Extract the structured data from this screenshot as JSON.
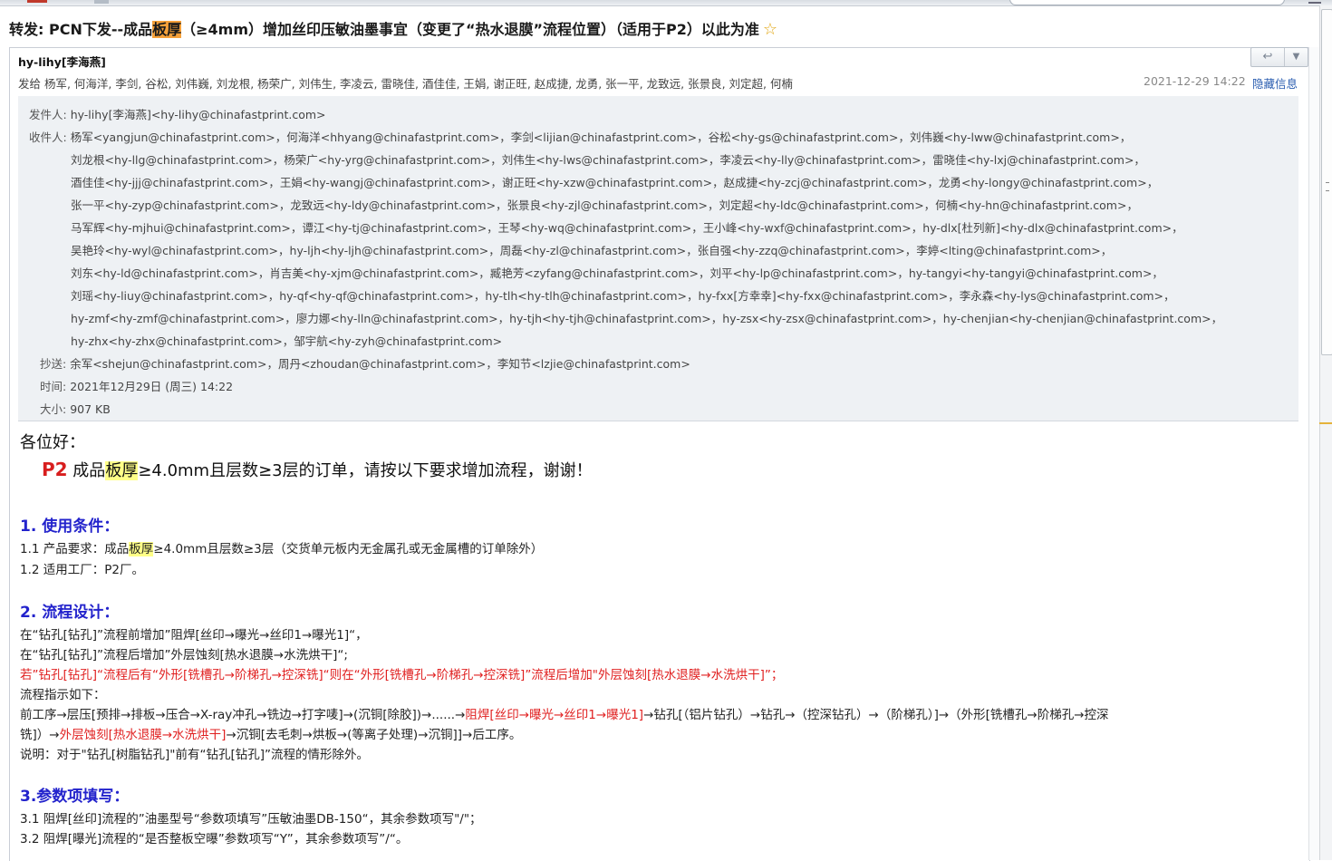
{
  "subject": {
    "before": "转发: PCN下发--成品",
    "highlight": "板厚",
    "after": "（≥4mm）增加丝印压敏油墨事宜（变更了“热水退膜”流程位置）（适用于P2）以此为准",
    "star": "☆"
  },
  "toolbar": {
    "reply_icon": "↩",
    "more_icon": "▼"
  },
  "header": {
    "sender": "hy-lihy[李海燕]",
    "send_to": "发给 杨军, 何海洋, 李剑, 谷松, 刘伟巍, 刘龙根, 杨荣广, 刘伟生, 李凌云, 雷晓佳, 酒佳佳, 王娟, 谢正旺, 赵成捷, 龙勇, 张一平, 龙致远, 张景良, 刘定超, 何楠",
    "date": "2021-12-29 14:22",
    "hide_info": "隐藏信息"
  },
  "details": {
    "from_label": "发件人: ",
    "from": "hy-lihy[李海燕]<hy-lihy@chinafastprint.com>",
    "to_label": "收件人: ",
    "to_lines": [
      "杨军<yangjun@chinafastprint.com>，何海洋<hhyang@chinafastprint.com>，李剑<lijian@chinafastprint.com>，谷松<hy-gs@chinafastprint.com>，刘伟巍<hy-lww@chinafastprint.com>，",
      "刘龙根<hy-llg@chinafastprint.com>，杨荣广<hy-yrg@chinafastprint.com>，刘伟生<hy-lws@chinafastprint.com>，李凌云<hy-lly@chinafastprint.com>，雷晓佳<hy-lxj@chinafastprint.com>，",
      "酒佳佳<hy-jjj@chinafastprint.com>，王娟<hy-wangj@chinafastprint.com>，谢正旺<hy-xzw@chinafastprint.com>，赵成捷<hy-zcj@chinafastprint.com>，龙勇<hy-longy@chinafastprint.com>，",
      "张一平<hy-zyp@chinafastprint.com>，龙致远<hy-ldy@chinafastprint.com>，张景良<hy-zjl@chinafastprint.com>，刘定超<hy-ldc@chinafastprint.com>，何楠<hy-hn@chinafastprint.com>，",
      "马军辉<hy-mjhui@chinafastprint.com>，谭江<hy-tj@chinafastprint.com>，王琴<hy-wq@chinafastprint.com>，王小峰<hy-wxf@chinafastprint.com>，hy-dlx[杜列新]<hy-dlx@chinafastprint.com>，",
      "吴艳玲<hy-wyl@chinafastprint.com>，hy-ljh<hy-ljh@chinafastprint.com>，周磊<hy-zl@chinafastprint.com>，张自强<hy-zzq@chinafastprint.com>，李婷<lting@chinafastprint.com>，",
      "刘东<hy-ld@chinafastprint.com>，肖吉美<hy-xjm@chinafastprint.com>，臧艳芳<zyfang@chinafastprint.com>，刘平<hy-lp@chinafastprint.com>，hy-tangyi<hy-tangyi@chinafastprint.com>，",
      "刘瑶<hy-liuy@chinafastprint.com>，hy-qf<hy-qf@chinafastprint.com>，hy-tlh<hy-tlh@chinafastprint.com>，hy-fxx[方幸幸]<hy-fxx@chinafastprint.com>，李永森<hy-lys@chinafastprint.com>，",
      "hy-zmf<hy-zmf@chinafastprint.com>，廖力娜<hy-lln@chinafastprint.com>，hy-tjh<hy-tjh@chinafastprint.com>，hy-zsx<hy-zsx@chinafastprint.com>，hy-chenjian<hy-chenjian@chinafastprint.com>，",
      "hy-zhx<hy-zhx@chinafastprint.com>，邹宇航<hy-zyh@chinafastprint.com>"
    ],
    "cc_label": "抄送: ",
    "cc": "余军<shejun@chinafastprint.com>，周丹<zhoudan@chinafastprint.com>，李知节<lzjie@chinafastprint.com>",
    "time_label": "时间: ",
    "time": "2021年12月29日 (周三) 14:22",
    "size_label": "大小: ",
    "size": "907 KB"
  },
  "body": {
    "greeting": "各位好：",
    "p2": "P2",
    "intro_a": " 成品",
    "intro_hl": "板厚",
    "intro_b": "≥4.0mm且层数≥3层的订单，请按以下要求增加流程，谢谢！",
    "s1_title": "1. 使用条件：",
    "s1_l1_a": "1.1  产品要求：成品",
    "s1_l1_hl": "板厚",
    "s1_l1_b": "≥4.0mm且层数≥3层（交货单元板内无金属孔或无金属槽的订单除外）",
    "s1_l2": "1.2  适用工厂：P2厂。",
    "s2_title": "2. 流程设计：",
    "s2_l1": "在“钻孔[钻孔]”流程前增加”阻焊[丝印→曝光→丝印1→曝光1]“，",
    "s2_l2": "在“钻孔[钻孔]”流程后增加”外层蚀刻[热水退膜→水洗烘干]“;",
    "s2_l3": "若”钻孔[钻孔]“流程后有“外形[铣槽孔→阶梯孔→控深铣]“则在“外形[铣槽孔→阶梯孔→控深铣]”流程后增加\"外层蚀刻[热水退膜→水洗烘干]”；",
    "s2_l4": "流程指示如下：",
    "s2_l5_a": "前工序→层压[预排→排板→压合→X-ray冲孔→铣边→打字唛]→(沉铜[除胶])→......→",
    "s2_l5_red": "阻焊[丝印→曝光→丝印1→曝光1]",
    "s2_l5_b": "→钻孔[（铝片钻孔）→钻孔→（控深钻孔）→（阶梯孔）]→（外形[铣槽孔→阶梯孔→控深",
    "s2_l6_a": "铣]）→",
    "s2_l6_red": "外层蚀刻[热水退膜→水洗烘干]",
    "s2_l6_b": "→沉铜[去毛刺→烘板→(等离子处理)→沉铜]]→后工序。",
    "s2_l7": "说明：对于\"钻孔[树脂钻孔]\"前有“钻孔[钻孔]”流程的情形除外。",
    "s3_title": "3.参数项填写：",
    "s3_l1": "3.1 阻焊[丝印]流程的”油墨型号“参数项填写”压敏油墨DB-150“，其余参数项写\"/\"；",
    "s3_l2": "3.2 阻焊[曝光]流程的“是否整板空曝”参数项写“Y”，其余参数项写”/“。"
  }
}
